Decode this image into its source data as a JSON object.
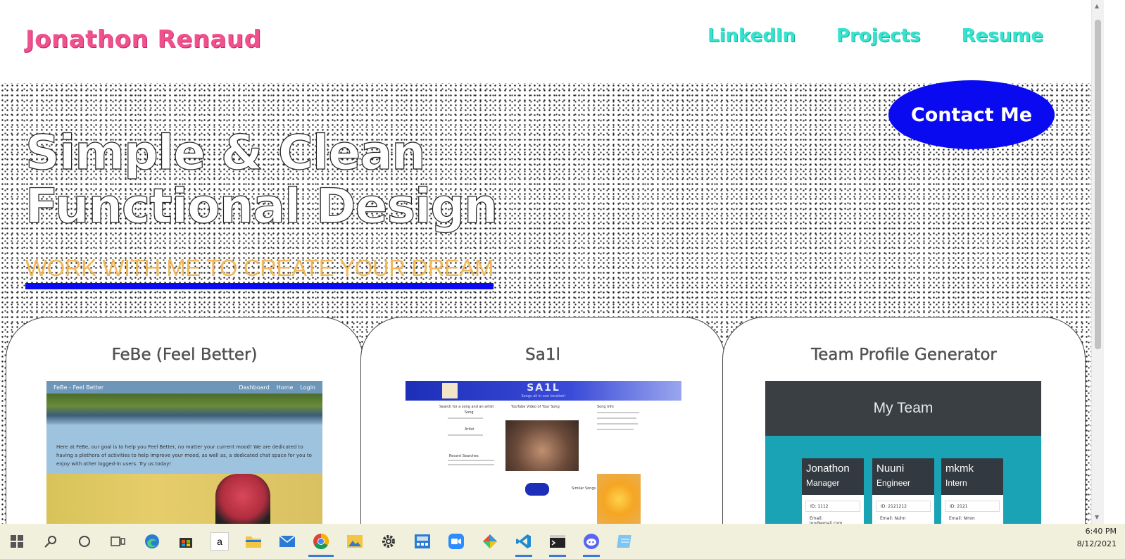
{
  "header": {
    "brand": "Jonathon Renaud",
    "nav": [
      "LinkedIn",
      "Projects",
      "Resume"
    ]
  },
  "hero": {
    "contact_label": "Contact Me",
    "headline_line1": "Simple & Clean",
    "headline_line2": "Functional Design",
    "tagline": "WORK WITH ME TO CREATE YOUR DREAM"
  },
  "projects": [
    {
      "title": "FeBe (Feel Better)",
      "preview": {
        "app_name": "FeBe - Feel Better",
        "nav_links": [
          "Dashboard",
          "Home",
          "Login"
        ],
        "blurb": "Here at FeBe, our goal is to help you Feel Better, no matter your current mood! We are dedicated to having a plethora of activities to help improve your mood, as well as, a dedicated chat space for you to enjoy with other logged-in users. Try us today!"
      }
    },
    {
      "title": "Sa1l",
      "preview": {
        "app_name": "SA1L",
        "subtitle": "Songs all in one location!",
        "search_heading": "Search for a song and an artist",
        "song_label": "Song",
        "artist_label": "Artist",
        "recent_label": "Recent Searches",
        "video_heading": "YouTube Video of Your Song",
        "info_heading": "Song Info",
        "similar_heading": "Similar Songs"
      }
    },
    {
      "title": "Team Profile Generator",
      "preview": {
        "header": "My Team",
        "members": [
          {
            "name": "Jonathon",
            "role": "Manager",
            "id": "ID: 1112",
            "email": "Email: jon@email.com"
          },
          {
            "name": "Nuuni",
            "role": "Engineer",
            "id": "ID: 2121212",
            "email": "Email: Nuhn"
          },
          {
            "name": "mkmk",
            "role": "Intern",
            "id": "ID: 2121",
            "email": "Email: Nmm"
          }
        ]
      }
    }
  ],
  "taskbar": {
    "icons": [
      "windows-icon",
      "search-icon",
      "cortana-icon",
      "task-view-icon",
      "edge-icon",
      "store-icon",
      "amazon-icon",
      "file-explorer-icon",
      "mail-icon",
      "chrome-icon",
      "photos-icon",
      "settings-icon",
      "calculator-icon",
      "zoom-icon",
      "paint-icon",
      "vscode-icon",
      "terminal-icon",
      "discord-icon",
      "notepad-icon"
    ],
    "time": "6:40 PM",
    "date": "8/12/2021"
  },
  "colors": {
    "brand": "#f0508c",
    "nav": "#35e3cf",
    "accent_blue": "#0a0af0",
    "tagline": "#f1b85a"
  }
}
